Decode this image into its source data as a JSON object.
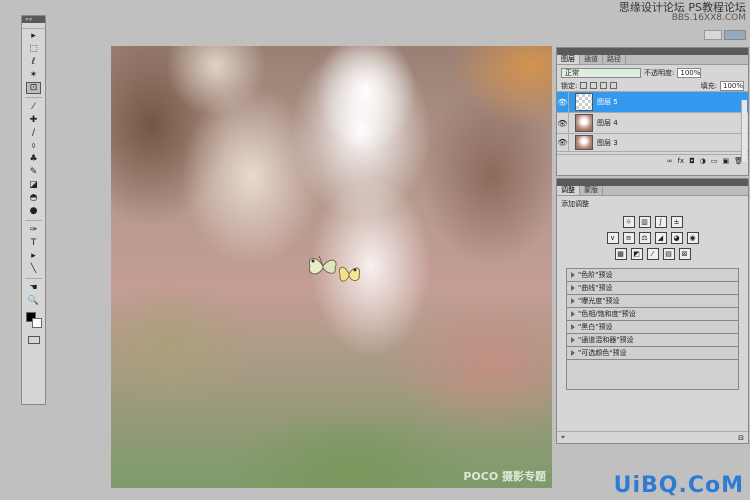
{
  "watermark": {
    "top_line1": "思缘设计论坛 PS教程论坛",
    "top_line2": "BBS.16XX8.COM",
    "poco": "POCO 摄影专题",
    "bottom": "UiBQ.CoM"
  },
  "toolbar": {
    "collapse_glyph": "««",
    "tools": [
      "▸",
      "⬚",
      "ℓ",
      "✶",
      "⊡",
      "⁄",
      "✚",
      "∕",
      "⬨",
      "♣",
      "✎",
      "◪",
      "◓",
      "●",
      "✑",
      "T",
      "▸",
      "╲",
      "☚",
      "🔍"
    ],
    "selected_index": 4
  },
  "layers_panel": {
    "tabs": [
      "图层",
      "通道",
      "路径"
    ],
    "blend_mode": "正常",
    "opacity_label": "不透明度:",
    "opacity_value": "100%",
    "lock_label": "锁定:",
    "fill_label": "填充:",
    "fill_value": "100%",
    "layers": [
      {
        "name": "图层 5",
        "selected": true,
        "thumb": "transparent"
      },
      {
        "name": "图层 4",
        "selected": false,
        "thumb": "photo"
      },
      {
        "name": "图层 3",
        "selected": false,
        "thumb": "photo"
      }
    ],
    "footer_icons": [
      "∞",
      "fx",
      "◘",
      "◑",
      "▭",
      "▣",
      "🗑"
    ]
  },
  "adjust_panel": {
    "tabs": [
      "调整",
      "蒙版"
    ],
    "title": "添加调整",
    "icon_rows": [
      [
        "☼",
        "▥",
        "∫",
        "±"
      ],
      [
        "∨",
        "≡",
        "⚖",
        "◢",
        "◕",
        "◉"
      ],
      [
        "▦",
        "◩",
        "⁄",
        "▤",
        "⊠"
      ]
    ],
    "presets": [
      "\"色阶\"预设",
      "\"曲线\"预设",
      "\"曝光度\"预设",
      "\"色相/饱和度\"预设",
      "\"黑白\"预设",
      "\"通道混和器\"预设",
      "\"可选颜色\"预设"
    ]
  }
}
